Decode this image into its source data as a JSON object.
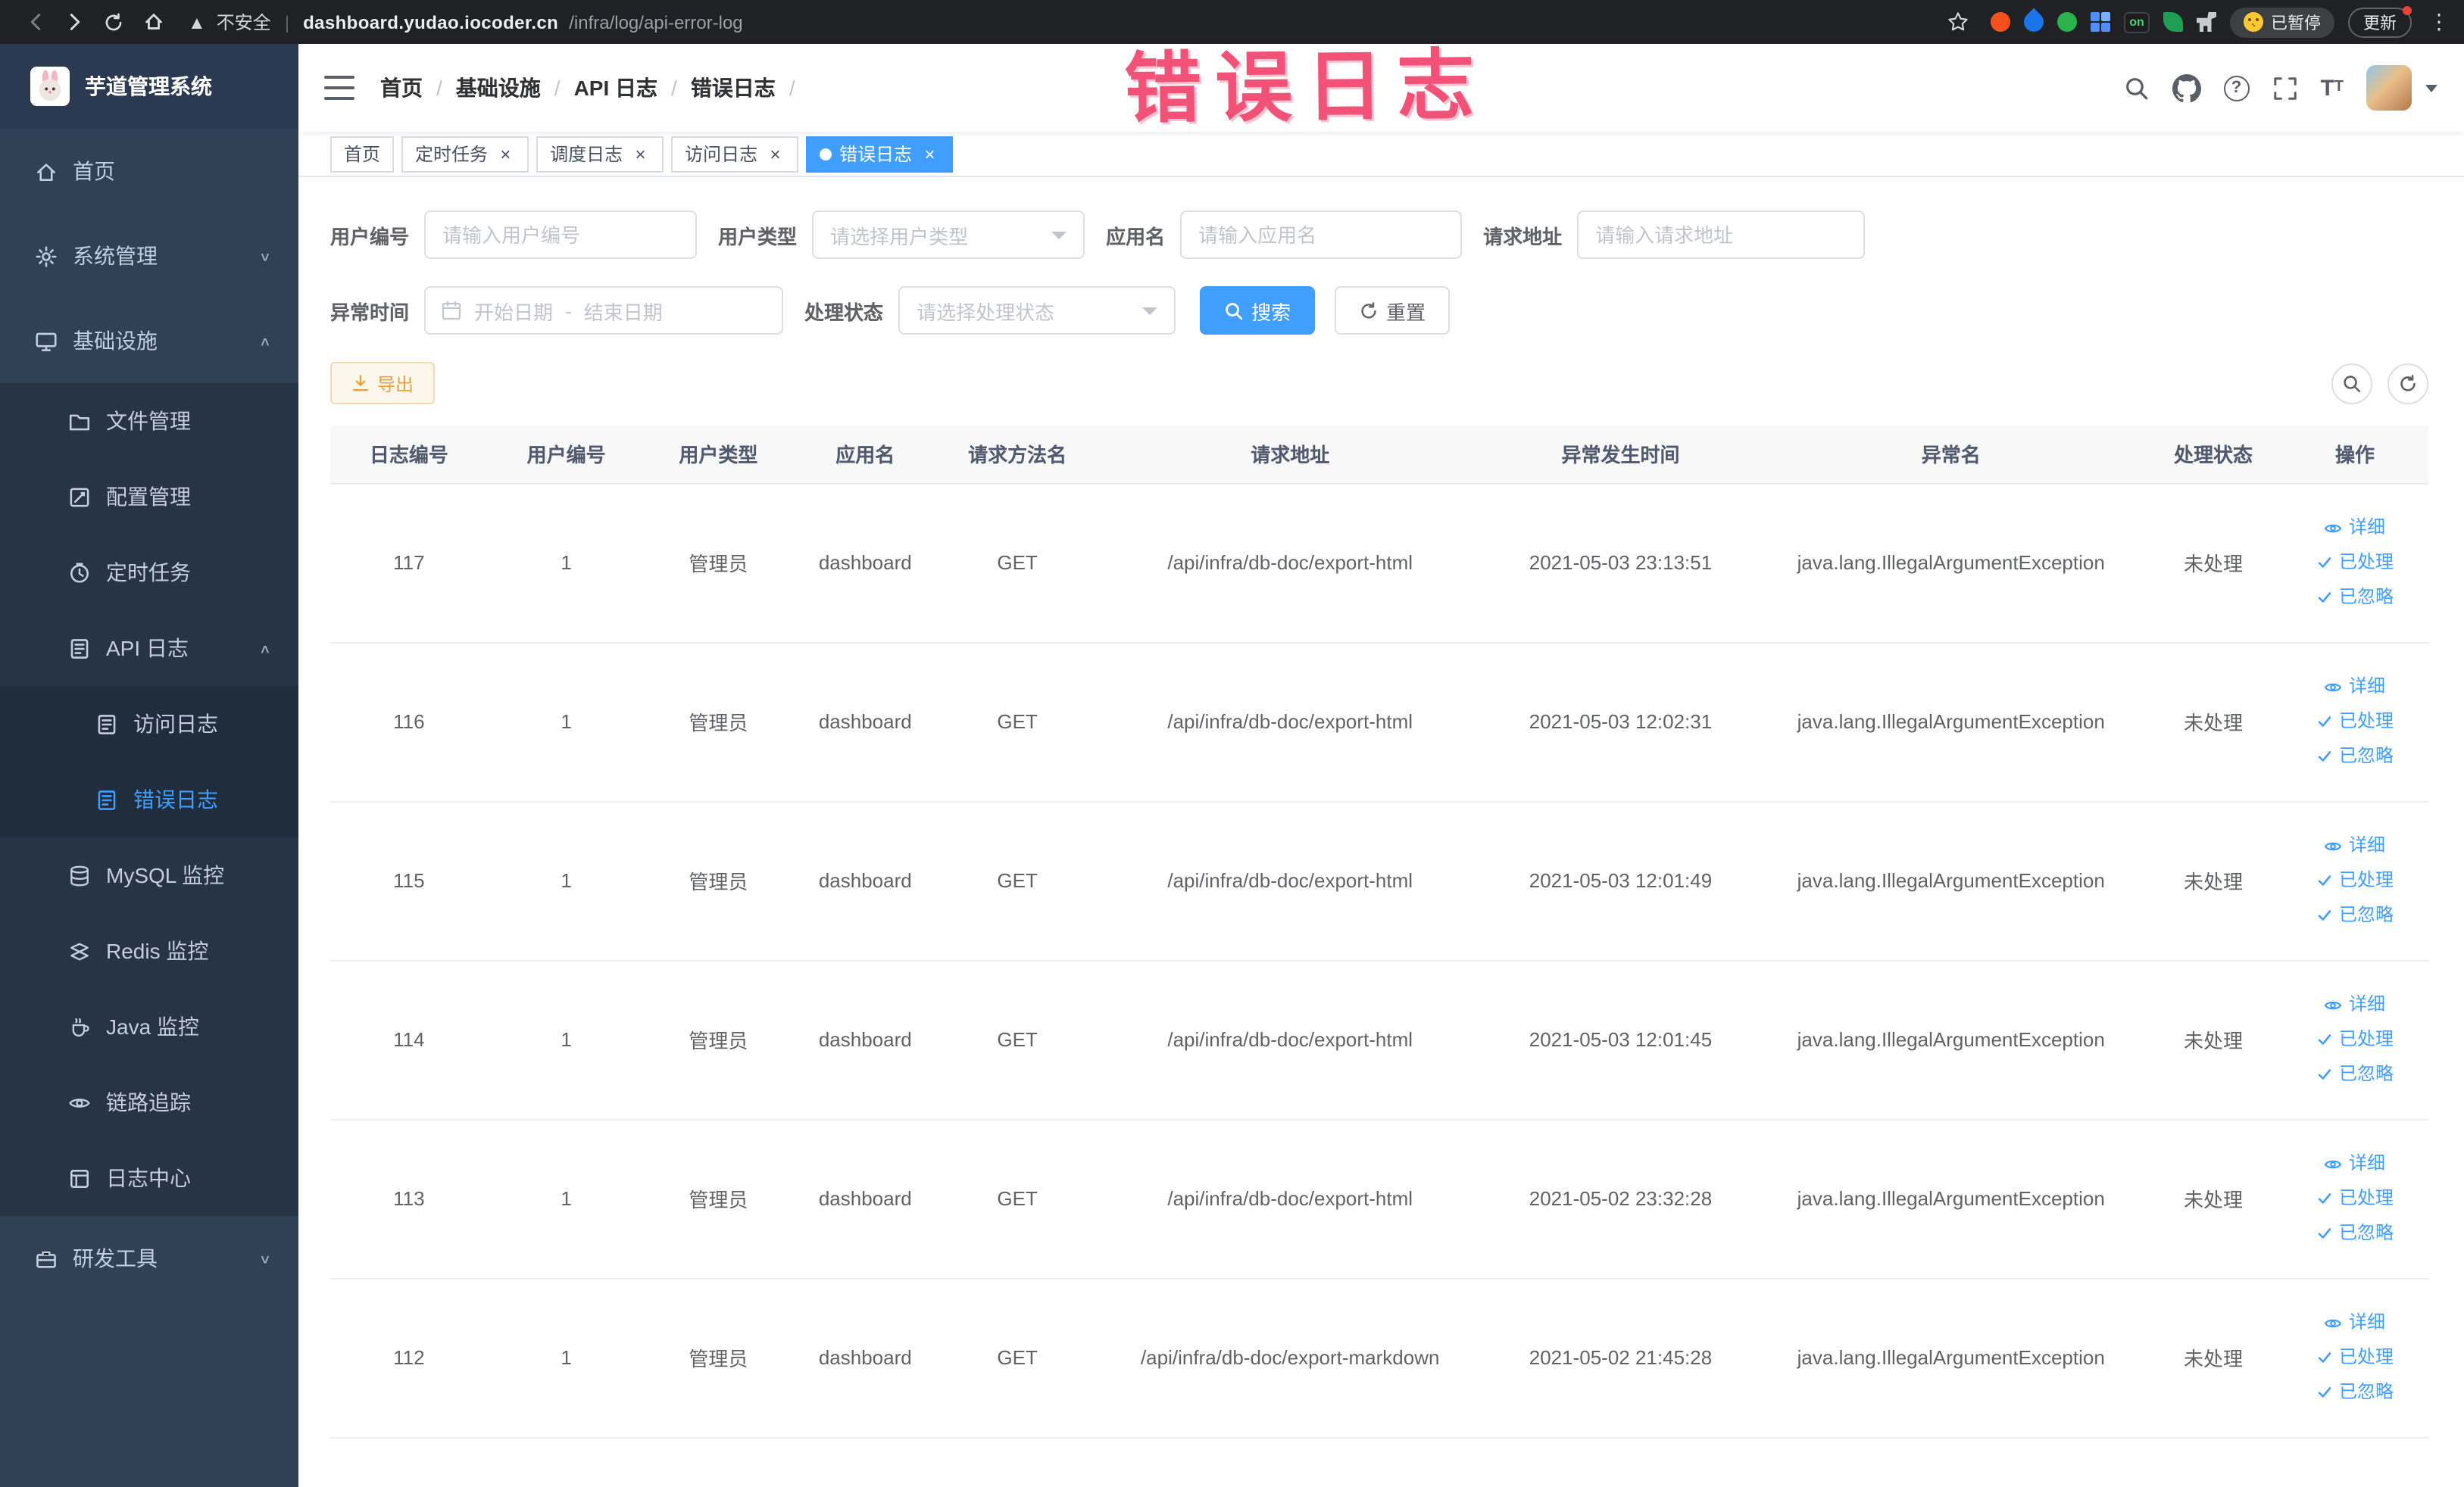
{
  "annotation": {
    "text": "错误日志"
  },
  "browser": {
    "security_label": "不安全",
    "url_host": "dashboard.yudao.iocoder.cn",
    "url_path": "/infra/log/api-error-log",
    "ext_on_label": "on",
    "paused_label": "已暂停",
    "update_label": "更新"
  },
  "sidebar": {
    "logo_title": "芋道管理系统",
    "menu": [
      {
        "label": "首页",
        "icon": "home-icon",
        "level": 1
      },
      {
        "label": "系统管理",
        "icon": "gear-icon",
        "level": 1,
        "chevron": "down"
      },
      {
        "label": "基础设施",
        "icon": "monitor-icon",
        "level": 1,
        "chevron": "up"
      },
      {
        "label": "文件管理",
        "icon": "folder-icon",
        "level": 2
      },
      {
        "label": "配置管理",
        "icon": "config-icon",
        "level": 2
      },
      {
        "label": "定时任务",
        "icon": "timer-icon",
        "level": 2
      },
      {
        "label": "API 日志",
        "icon": "log-icon",
        "level": 2,
        "chevron": "up"
      },
      {
        "label": "访问日志",
        "icon": "log-icon",
        "level": 3
      },
      {
        "label": "错误日志",
        "icon": "log-icon",
        "level": 3,
        "active": true
      },
      {
        "label": "MySQL 监控",
        "icon": "database-icon",
        "level": 2
      },
      {
        "label": "Redis 监控",
        "icon": "redis-icon",
        "level": 2
      },
      {
        "label": "Java 监控",
        "icon": "java-icon",
        "level": 2
      },
      {
        "label": "链路追踪",
        "icon": "eye-icon",
        "level": 2
      },
      {
        "label": "日志中心",
        "icon": "log-center-icon",
        "level": 2
      },
      {
        "label": "研发工具",
        "icon": "tools-icon",
        "level": 1,
        "chevron": "down"
      }
    ]
  },
  "header": {
    "breadcrumb": [
      "首页",
      "基础设施",
      "API 日志",
      "错误日志"
    ]
  },
  "tabs": [
    {
      "label": "首页",
      "closable": false,
      "active": false
    },
    {
      "label": "定时任务",
      "closable": true,
      "active": false
    },
    {
      "label": "调度日志",
      "closable": true,
      "active": false
    },
    {
      "label": "访问日志",
      "closable": true,
      "active": false
    },
    {
      "label": "错误日志",
      "closable": true,
      "active": true
    }
  ],
  "filters": {
    "user_id": {
      "label": "用户编号",
      "placeholder": "请输入用户编号"
    },
    "user_type": {
      "label": "用户类型",
      "placeholder": "请选择用户类型"
    },
    "app_name": {
      "label": "应用名",
      "placeholder": "请输入应用名"
    },
    "request_url": {
      "label": "请求地址",
      "placeholder": "请输入请求地址"
    },
    "exception_time": {
      "label": "异常时间",
      "start_placeholder": "开始日期",
      "separator": "-",
      "end_placeholder": "结束日期"
    },
    "process_status": {
      "label": "处理状态",
      "placeholder": "请选择处理状态"
    },
    "search_label": "搜索",
    "reset_label": "重置"
  },
  "toolbar": {
    "export_label": "导出"
  },
  "table": {
    "columns": [
      "日志编号",
      "用户编号",
      "用户类型",
      "应用名",
      "请求方法名",
      "请求地址",
      "异常发生时间",
      "异常名",
      "处理状态",
      "操作"
    ],
    "action_labels": [
      "详细",
      "已处理",
      "已忽略"
    ],
    "rows": [
      {
        "id": "117",
        "user_id": "1",
        "user_type": "管理员",
        "app": "dashboard",
        "method": "GET",
        "url": "/api/infra/db-doc/export-html",
        "time": "2021-05-03 23:13:51",
        "exception": "java.lang.IllegalArgumentException",
        "status": "未处理"
      },
      {
        "id": "116",
        "user_id": "1",
        "user_type": "管理员",
        "app": "dashboard",
        "method": "GET",
        "url": "/api/infra/db-doc/export-html",
        "time": "2021-05-03 12:02:31",
        "exception": "java.lang.IllegalArgumentException",
        "status": "未处理"
      },
      {
        "id": "115",
        "user_id": "1",
        "user_type": "管理员",
        "app": "dashboard",
        "method": "GET",
        "url": "/api/infra/db-doc/export-html",
        "time": "2021-05-03 12:01:49",
        "exception": "java.lang.IllegalArgumentException",
        "status": "未处理"
      },
      {
        "id": "114",
        "user_id": "1",
        "user_type": "管理员",
        "app": "dashboard",
        "method": "GET",
        "url": "/api/infra/db-doc/export-html",
        "time": "2021-05-03 12:01:45",
        "exception": "java.lang.IllegalArgumentException",
        "status": "未处理"
      },
      {
        "id": "113",
        "user_id": "1",
        "user_type": "管理员",
        "app": "dashboard",
        "method": "GET",
        "url": "/api/infra/db-doc/export-html",
        "time": "2021-05-02 23:32:28",
        "exception": "java.lang.IllegalArgumentException",
        "status": "未处理"
      },
      {
        "id": "112",
        "user_id": "1",
        "user_type": "管理员",
        "app": "dashboard",
        "method": "GET",
        "url": "/api/infra/db-doc/export-markdown",
        "time": "2021-05-02 21:45:28",
        "exception": "java.lang.IllegalArgumentException",
        "status": "未处理"
      }
    ]
  }
}
